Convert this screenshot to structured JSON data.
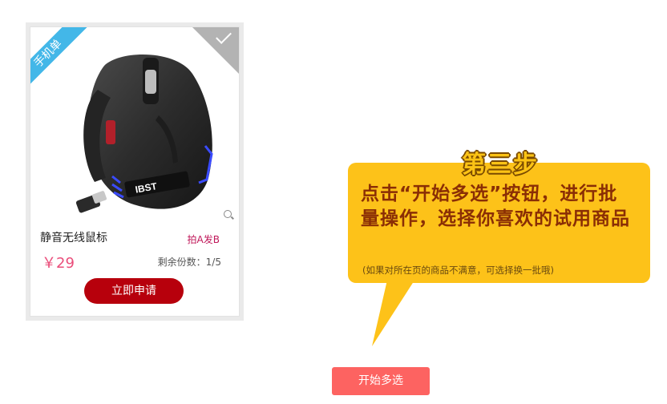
{
  "product_card": {
    "corner_tag": "手机单",
    "name": "静音无线鼠标",
    "delivery_tag": "拍A发B",
    "price": "￥29",
    "remaining": "剩余份数：1/5",
    "apply_label": "立即申请",
    "image_brand_text": "IBST",
    "selected": true
  },
  "tutorial_bubble": {
    "step_title": "第三步",
    "main_text": "点击“开始多选”按钮，进行批量操作，选择你喜欢的试用商品",
    "note": "(如果对所在页的商品不满意，可选择换一批哦)"
  },
  "multi_select_button": {
    "label": "开始多选"
  },
  "colors": {
    "apply_button": "#b7000c",
    "multi_select_button": "#fd6361",
    "bubble_bg": "#fdc219",
    "price": "#ea4d7a",
    "corner_tag": "#43b7e8"
  }
}
